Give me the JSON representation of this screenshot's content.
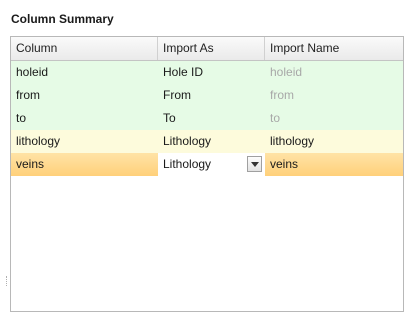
{
  "panel": {
    "title": "Column Summary"
  },
  "table": {
    "headers": [
      "Column",
      "Import As",
      "Import Name"
    ],
    "rows": [
      {
        "column": "holeid",
        "import_as": "Hole ID",
        "import_name": "holeid",
        "state": "mapped",
        "name_dim": true
      },
      {
        "column": "from",
        "import_as": "From",
        "import_name": "from",
        "state": "mapped",
        "name_dim": true
      },
      {
        "column": "to",
        "import_as": "To",
        "import_name": "to",
        "state": "mapped",
        "name_dim": true
      },
      {
        "column": "lithology",
        "import_as": "Lithology",
        "import_name": "lithology",
        "state": "partial",
        "name_dim": false
      },
      {
        "column": "veins",
        "import_as": "Lithology",
        "import_name": "veins",
        "state": "selected",
        "name_dim": false
      }
    ]
  },
  "colors": {
    "mapped_row": "#e6fbe6",
    "partial_row": "#fdfbdc",
    "selected_row": "#ffd07a",
    "dim_text": "#a8a8a8"
  },
  "icons": {
    "dropdown": "chevron-down-icon"
  }
}
